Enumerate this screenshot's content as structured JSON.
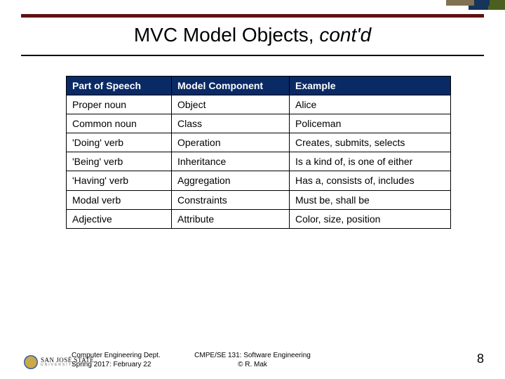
{
  "title": {
    "main": "MVC Model Objects, ",
    "ital": "cont'd"
  },
  "table": {
    "headers": [
      "Part of Speech",
      "Model Component",
      "Example"
    ],
    "rows": [
      [
        "Proper noun",
        "Object",
        "Alice"
      ],
      [
        "Common noun",
        "Class",
        "Policeman"
      ],
      [
        "'Doing' verb",
        "Operation",
        "Creates, submits, selects"
      ],
      [
        "'Being' verb",
        "Inheritance",
        "Is a kind of, is one of either"
      ],
      [
        "'Having' verb",
        "Aggregation",
        "Has a, consists of, includes"
      ],
      [
        "Modal verb",
        "Constraints",
        "Must be, shall be"
      ],
      [
        "Adjective",
        "Attribute",
        "Color, size, position"
      ]
    ]
  },
  "footer": {
    "logo_name": "SAN JOSÉ STATE",
    "logo_uni": "UNIVERSITY",
    "left_line1": "Computer Engineering Dept.",
    "left_line2": "Spring 2017: February 22",
    "center_line1": "CMPE/SE 131: Software Engineering",
    "center_line2": "© R. Mak",
    "page": "8"
  }
}
